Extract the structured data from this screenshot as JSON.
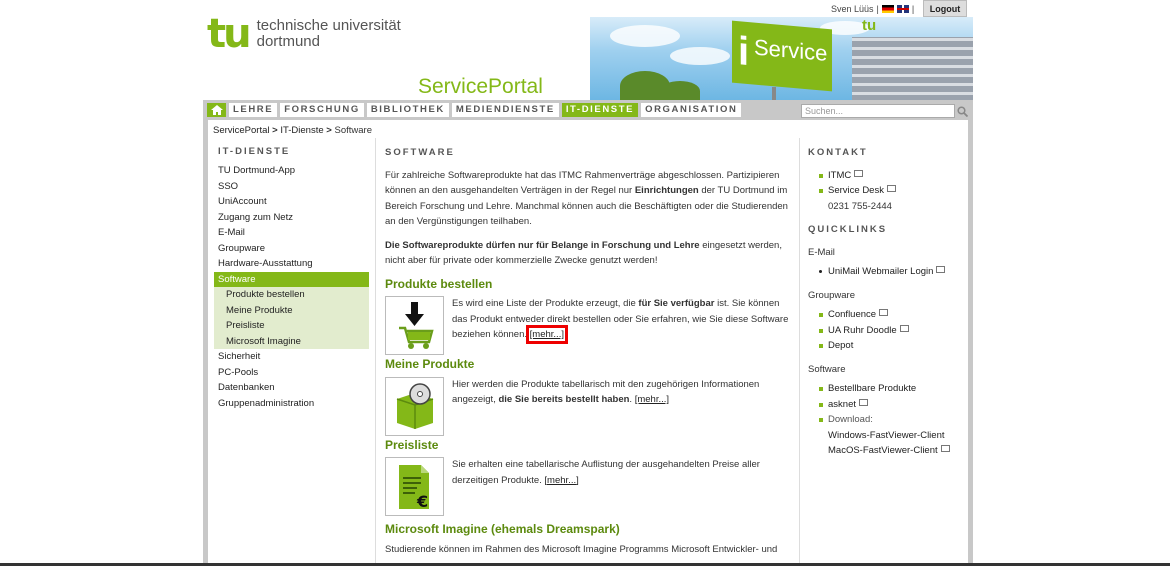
{
  "user": {
    "name": "Sven Lüüs",
    "separator": "|",
    "separator2": "|",
    "logout": "Logout"
  },
  "logo": {
    "mark": "tu",
    "line1": "technische universität",
    "line2": "dortmund"
  },
  "portal_title": "ServicePortal",
  "banner": {
    "sign_i": "i",
    "sign_text": "Service",
    "mini_logo": "tu"
  },
  "nav": {
    "items": [
      "LEHRE",
      "FORSCHUNG",
      "BIBLIOTHEK",
      "MEDIENDIENSTE",
      "IT-DIENSTE",
      "ORGANISATION"
    ],
    "active": "IT-DIENSTE",
    "search_placeholder": "Suchen..."
  },
  "breadcrumb": {
    "a": "ServicePortal",
    "b": "IT-Dienste",
    "c": "Software",
    "sep": ">"
  },
  "sidebar": {
    "heading": "IT-DIENSTE",
    "items": [
      "TU Dortmund-App",
      "SSO",
      "UniAccount",
      "Zugang zum Netz",
      "E-Mail",
      "Groupware",
      "Hardware-Ausstattung"
    ],
    "active": "Software",
    "sub": [
      "Produkte bestellen",
      "Meine Produkte",
      "Preisliste",
      "Microsoft Imagine"
    ],
    "after": [
      "Sicherheit",
      "PC-Pools",
      "Datenbanken",
      "Gruppenadministration"
    ]
  },
  "main": {
    "heading": "SOFTWARE",
    "intro_1": "Für zahlreiche Softwareprodukte hat das ITMC Rahmenverträge abgeschlossen. Partizipieren können an den ausgehandelten Verträgen in der Regel nur ",
    "intro_bold": "Einrichtungen",
    "intro_2": " der TU Dortmund im Bereich Forschung und Lehre. Manchmal können auch die Beschäftigten oder die Studierenden an den Vergünstigungen teilhaben.",
    "notice_bold": "Die Softwareprodukte dürfen nur für Belange in Forschung und Lehre",
    "notice_rest": " eingesetzt werden, nicht aber für private oder kommerzielle Zwecke genutzt werden!",
    "sections": [
      {
        "title": "Produkte bestellen",
        "text_a": "Es wird eine Liste der Produkte erzeugt, die ",
        "text_bold": "für Sie verfügbar",
        "text_b": " ist. Sie können das Produkt entweder direkt bestellen oder Sie erfahren, wie Sie diese Software beziehen können. ",
        "more": "[mehr...]"
      },
      {
        "title": "Meine Produkte",
        "text_a": "Hier werden die Produkte tabellarisch mit den zugehörigen Informationen angezeigt, ",
        "text_bold": "die Sie bereits bestellt haben",
        "text_b": ". ",
        "more": "[mehr...]"
      },
      {
        "title": "Preisliste",
        "text_a": "Sie erhalten eine tabellarische Auflistung der ausgehandelten Preise aller derzeitigen Produkte. ",
        "text_bold": "",
        "text_b": "",
        "more": "[mehr...]"
      },
      {
        "title": "Microsoft Imagine (ehemals Dreamspark)",
        "text_a": "Studierende können im Rahmen des Microsoft Imagine Programms Microsoft Entwickler- und",
        "text_bold": "",
        "text_b": "",
        "more": ""
      }
    ]
  },
  "right": {
    "kontakt_heading": "KONTAKT",
    "kontakt": [
      "ITMC",
      "Service Desk"
    ],
    "phone": "0231 755-2444",
    "quick_heading": "QUICKLINKS",
    "email_label": "E-Mail",
    "email_links": [
      "UniMail Webmailer Login"
    ],
    "groupware_label": "Groupware",
    "groupware_links": [
      "Confluence",
      "UA Ruhr Doodle",
      "Depot"
    ],
    "software_label": "Software",
    "software_links": [
      "Bestellbare Produkte",
      "asknet"
    ],
    "download_label": "Download:",
    "download_links": [
      "Windows-FastViewer-Client",
      "MacOS-FastViewer-Client"
    ]
  },
  "colors": {
    "accent": "#84b818",
    "highlight": "#e00000"
  }
}
